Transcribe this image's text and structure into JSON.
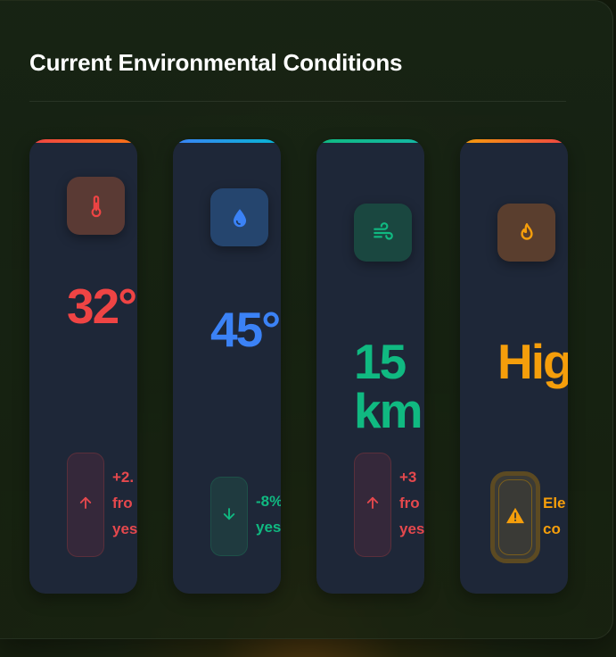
{
  "section": {
    "title": "Current Environmental Conditions"
  },
  "cards": [
    {
      "metric": "temperature",
      "icon": "thermometer-icon",
      "value": "32°",
      "trend_direction": "up",
      "trend_lines": [
        "+2.",
        "fro",
        "yes"
      ],
      "accent_color": "#ef4444"
    },
    {
      "metric": "humidity",
      "icon": "droplet-icon",
      "value": "45°",
      "trend_direction": "down",
      "trend_lines": [
        "-8%",
        "yes"
      ],
      "accent_color": "#3b82f6"
    },
    {
      "metric": "wind",
      "icon": "wind-icon",
      "value_lines": [
        "15",
        "km"
      ],
      "trend_direction": "up",
      "trend_lines": [
        "+3",
        "fro",
        "yes"
      ],
      "accent_color": "#10b981"
    },
    {
      "metric": "fire-risk",
      "icon": "flame-icon",
      "value": "Hig",
      "trend_direction": "warning",
      "trend_lines": [
        "Ele",
        "co"
      ],
      "accent_color": "#f59e0b"
    }
  ]
}
